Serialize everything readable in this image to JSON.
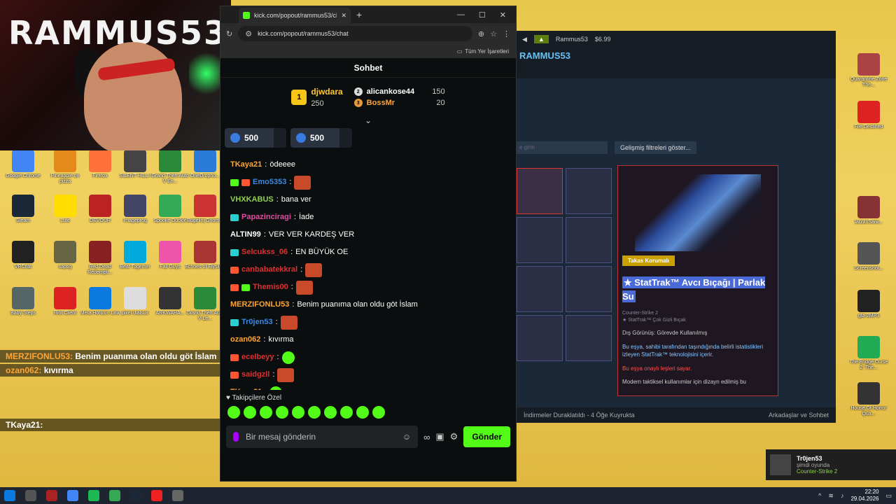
{
  "desktop": {
    "left_icons": [
      {
        "label": "Google Chrome",
        "color": "#4285f4"
      },
      {
        "label": "Pineapple on pizza",
        "color": "#e58a1a"
      },
      {
        "label": "Firefox",
        "color": "#ff7139"
      },
      {
        "label": "SILENT HILL f",
        "color": "#444"
      },
      {
        "label": "Grand Theft Auto V En...",
        "color": "#2a8a3a"
      },
      {
        "label": "OneDropho...",
        "color": "#2a7ad8"
      },
      {
        "label": "Steam",
        "color": "#1b2838"
      },
      {
        "label": "Lute",
        "color": "#ffdd00"
      },
      {
        "label": "DEVOUR",
        "color": "#b22"
      },
      {
        "label": "Imageprog",
        "color": "#446"
      },
      {
        "label": "Spooke Duckle",
        "color": "#3a5"
      },
      {
        "label": "Bugelinj Gnom...",
        "color": "#c33"
      },
      {
        "label": "VRChat",
        "color": "#222"
      },
      {
        "label": "saptig",
        "color": "#664"
      },
      {
        "label": "Red Dead Redempti...",
        "color": "#822"
      },
      {
        "label": "Beat Together",
        "color": "#0ad"
      },
      {
        "label": "Fall Guys",
        "color": "#e5a"
      },
      {
        "label": "Echoes of Elysium",
        "color": "#a33"
      },
      {
        "label": "Baby Steps",
        "color": "#566"
      },
      {
        "label": "Riot Client",
        "color": "#d22"
      },
      {
        "label": "Meta Horizon Link",
        "color": "#0a7ae0"
      },
      {
        "label": "pixel dialsuit",
        "color": "#ddd"
      },
      {
        "label": "ARKWAHA...",
        "color": "#333"
      },
      {
        "label": "Grand Theft Auto V Le...",
        "color": "#2a8a3a"
      }
    ],
    "right_icons": [
      {
        "label": "Quarantine Zone The...",
        "color": "#a44"
      },
      {
        "label": "File Destined",
        "color": "#d22"
      },
      {
        "label": "farzanSaiw...",
        "color": "#833"
      },
      {
        "label": "Screenshot...",
        "color": "#555"
      },
      {
        "label": "gta-2MP3",
        "color": "#222"
      },
      {
        "label": "The Bridge Curse 2: The...",
        "color": "#2a5"
      },
      {
        "label": "House Of Horror Qua...",
        "color": "#333"
      }
    ]
  },
  "webcam": {
    "brand": "RAMMUS53"
  },
  "stream_chat": [
    {
      "user": "MERZIFONLU53:",
      "text": "Benim puanıma olan oldu göt İslam"
    },
    {
      "user": "ozan062:",
      "text": "kıvırma"
    },
    {
      "user": "TKaya21:",
      "text": ""
    }
  ],
  "browser": {
    "tab_title": "kick.com/popout/rammus53/cl",
    "url": "kick.com/popout/rammus53/chat",
    "bookmarks_label": "Tüm Yer İşaretleri",
    "chat_title": "Sohbet",
    "leaderboard": {
      "first": {
        "rank": "1",
        "name": "djwdara",
        "points": "250"
      },
      "second": {
        "rank": "2",
        "name": "alicankose44",
        "points": "150"
      },
      "third": {
        "rank": "3",
        "name": "BossMr",
        "points": "20"
      }
    },
    "pins": [
      {
        "value": "500"
      },
      {
        "value": "500"
      }
    ],
    "messages": [
      {
        "user": "TKaya21",
        "text": "ödeeee",
        "color": "#ffa534",
        "badges": [],
        "emote": ""
      },
      {
        "user": "Emo5353",
        "text": "",
        "color": "#3a8ae0",
        "badges": [
          "#53fc18",
          "#ff5533"
        ],
        "emote": "red"
      },
      {
        "user": "VHXKABUS",
        "text": "bana ver",
        "color": "#8fd14f",
        "badges": [],
        "emote": ""
      },
      {
        "user": "Papazinciragi",
        "text": "İade",
        "color": "#e04aa0",
        "badges": [
          "#2ad0d0"
        ],
        "emote": ""
      },
      {
        "user": "ALTIN99",
        "text": "VER VER KARDEŞ VER",
        "color": "#ffffff",
        "badges": [],
        "emote": ""
      },
      {
        "user": "Selcukss_06",
        "text": "EN BÜYÜK OE",
        "color": "#e03030",
        "badges": [
          "#2ad0d0"
        ],
        "emote": ""
      },
      {
        "user": "canbabatekkral",
        "text": "",
        "color": "#e03030",
        "badges": [
          "#ff5533"
        ],
        "emote": "red"
      },
      {
        "user": "Themis00",
        "text": "",
        "color": "#e03030",
        "badges": [
          "#ff5533",
          "#53fc18"
        ],
        "emote": "red"
      },
      {
        "user": "MERZIFONLU53",
        "text": "Benim puanıma olan oldu göt İslam",
        "color": "#ffa534",
        "badges": [],
        "emote": ""
      },
      {
        "user": "Tr0jen53",
        "text": "",
        "color": "#3a8ae0",
        "badges": [
          "#2ad0d0"
        ],
        "emote": "red"
      },
      {
        "user": "ozan062",
        "text": "kıvırma",
        "color": "#ffa534",
        "badges": [],
        "emote": ""
      },
      {
        "user": "ecelbeyy",
        "text": "",
        "color": "#e03030",
        "badges": [
          "#ff5533"
        ],
        "emote": "green"
      },
      {
        "user": "saidgzll",
        "text": "",
        "color": "#e03030",
        "badges": [
          "#ff5533"
        ],
        "emote": "red"
      },
      {
        "user": "TKaya21",
        "text": "",
        "color": "#ffa534",
        "badges": [],
        "emote": "green"
      }
    ],
    "followers_label": "Takipçilere Özel",
    "input_placeholder": "Bir mesaj gönderin",
    "send_label": "Gönder"
  },
  "steam": {
    "account": "Rammus53",
    "balance": "$6.99",
    "title": "RAMMUS53",
    "search_placeholder": "e girin",
    "filters_label": "Gelişmiş filtreleri göster...",
    "item": {
      "protection": "Takas Korumalı",
      "name": "★ StatTrak™ Avcı Bıçağı | Parlak Su",
      "game": "Counter-Strike 2",
      "type": "★ StatTrak™ Çok Gizli Bıçak",
      "exterior": "Dış Görünüş: Görevde Kullanılmış",
      "stattrak_note": "Bu eşya, sahibi tarafından taşındığında belirli istatistikleri izleyen StatTrak™ teknolojisini içerir.",
      "warning": "Bu eşya onaylı leşleri sayar.",
      "description": "Modern taktiksel kullanımlar için dizayn edilmiş bu"
    },
    "downloads": "İndirmeler Duraklatıldı - 4 Öğe Kuyrukta",
    "friends": "Arkadaşlar ve Sohbet"
  },
  "notification": {
    "user": "Tr0jen53",
    "status": "şimdi oyunda",
    "game": "Counter-Strike 2"
  },
  "taskbar": {
    "time": "22:20",
    "date": "29.04.2026"
  }
}
